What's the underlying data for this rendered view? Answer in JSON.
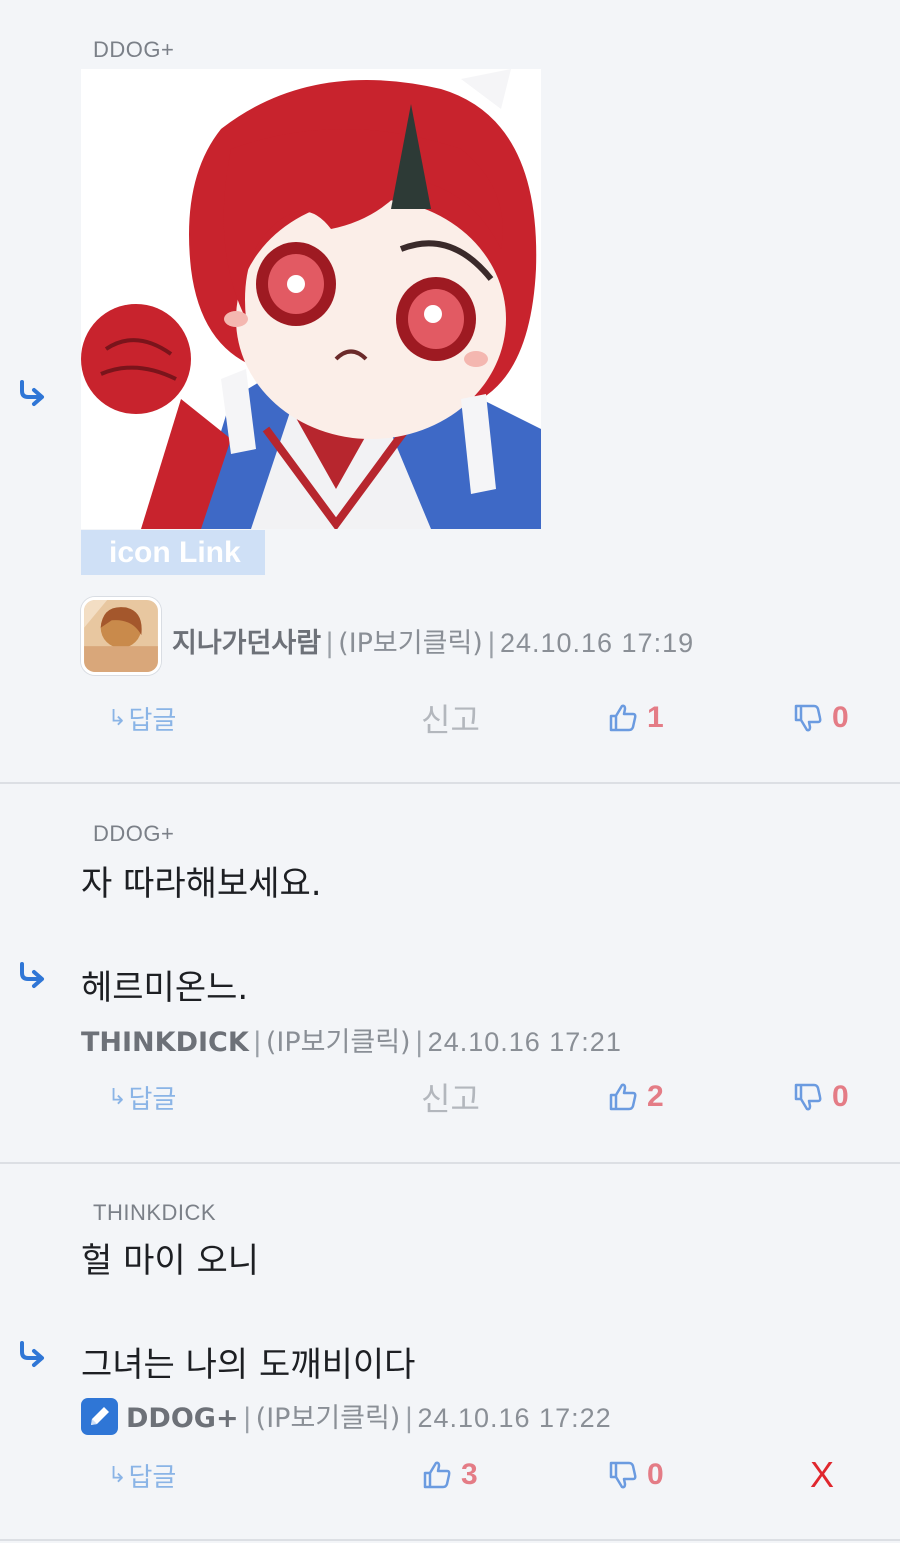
{
  "comments": [
    {
      "mention": "DDOG+",
      "sticker_label": "icon Link",
      "author": "지나가던사람",
      "ip_label": "(IP보기클릭)",
      "timestamp": "24.10.16 17:19",
      "reply_label": "답글",
      "report_label": "신고",
      "likes": "1",
      "dislikes": "0"
    },
    {
      "mention": "DDOG+",
      "line1": "자 따라해보세요.",
      "line2": "헤르미온느.",
      "author": "THINKDICK",
      "ip_label": "(IP보기클릭)",
      "timestamp": "24.10.16 17:21",
      "reply_label": "답글",
      "report_label": "신고",
      "likes": "2",
      "dislikes": "0"
    },
    {
      "mention": "THINKDICK",
      "line1": "헐 마이 오니",
      "line2": "그녀는 나의 도깨비이다",
      "author": "DDOG+",
      "ip_label": "(IP보기클릭)",
      "timestamp": "24.10.16 17:22",
      "reply_label": "답글",
      "likes": "3",
      "dislikes": "0",
      "delete_label": "X"
    }
  ],
  "colors": {
    "reply_arrow": "#2f76d6",
    "vote_count": "#e47c86",
    "delete": "#e0272e",
    "badge": "#2f76d6"
  },
  "icons": [
    "reply-arrow-icon",
    "thumbs-up-icon",
    "thumbs-down-icon",
    "edit-pencil-icon"
  ]
}
